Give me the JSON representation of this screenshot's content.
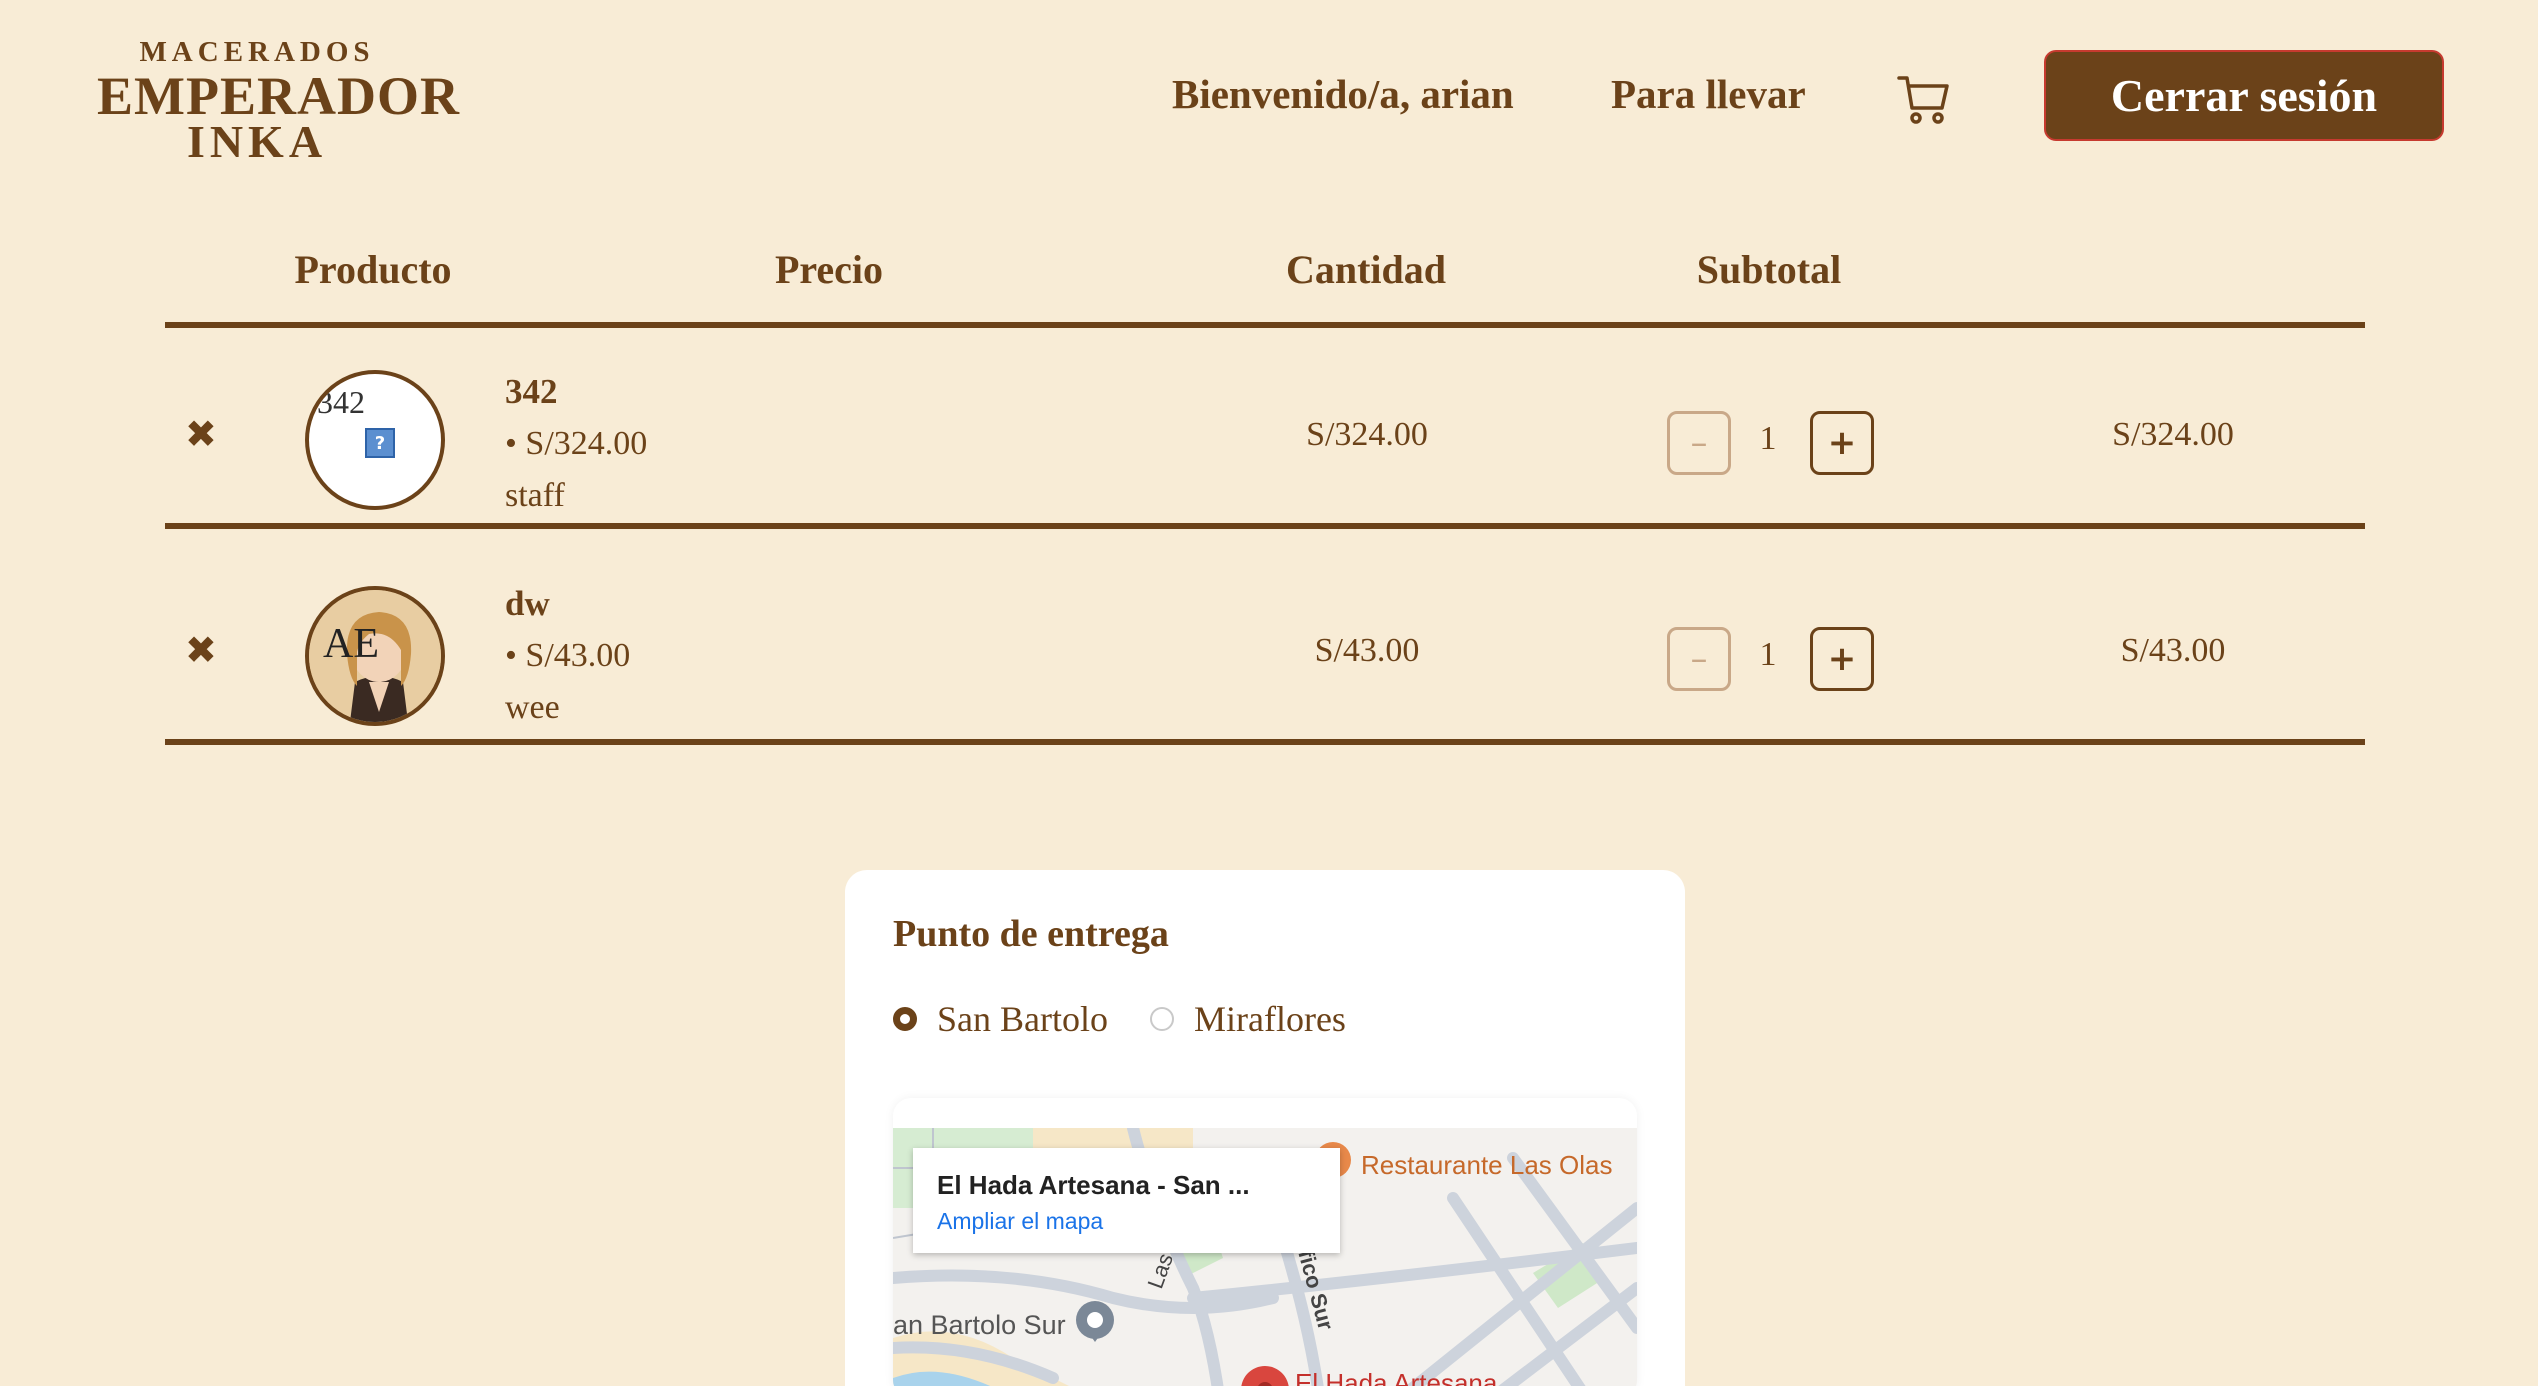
{
  "header": {
    "logo": {
      "line1": "MACERADOS",
      "line2": "EMPERADOR",
      "line3": "INKA"
    },
    "welcome": "Bienvenido/a, arian",
    "takeaway": "Para llevar",
    "cart_icon": "shopping-cart-icon",
    "logout": "Cerrar sesión"
  },
  "table": {
    "headers": {
      "product": "Producto",
      "price": "Precio",
      "quantity": "Cantidad",
      "subtotal": "Subtotal"
    },
    "rows": [
      {
        "remove_icon": "close-icon",
        "image_alt": "342",
        "name": "342",
        "unit_price": "• S/324.00",
        "description": "staff",
        "price": "S/324.00",
        "quantity": "1",
        "subtotal": "S/324.00"
      },
      {
        "remove_icon": "close-icon",
        "image_overlay": "AE",
        "name": "dw",
        "unit_price": "• S/43.00",
        "description": "wee",
        "price": "S/43.00",
        "quantity": "1",
        "subtotal": "S/43.00"
      }
    ],
    "minus_symbol": "–",
    "plus_symbol": "+"
  },
  "delivery": {
    "title": "Punto de entrega",
    "options": [
      {
        "label": "San Bartolo",
        "selected": true
      },
      {
        "label": "Miraflores",
        "selected": false
      }
    ],
    "map": {
      "popup_title": "El Hada Artesana - San ...",
      "popup_link": "Ampliar el mapa",
      "labels": {
        "restaurant": "Restaurante Las Olas",
        "district": "an Bartolo Sur",
        "marker": "El Hada Artesana",
        "street1": "Las",
        "street2": "cifico Sur"
      }
    }
  },
  "colors": {
    "background": "#f8ecd6",
    "brand_brown": "#6b4219",
    "logout_border": "#c63a2f",
    "map_link": "#1a73e8",
    "marker_red": "#c4302b"
  }
}
